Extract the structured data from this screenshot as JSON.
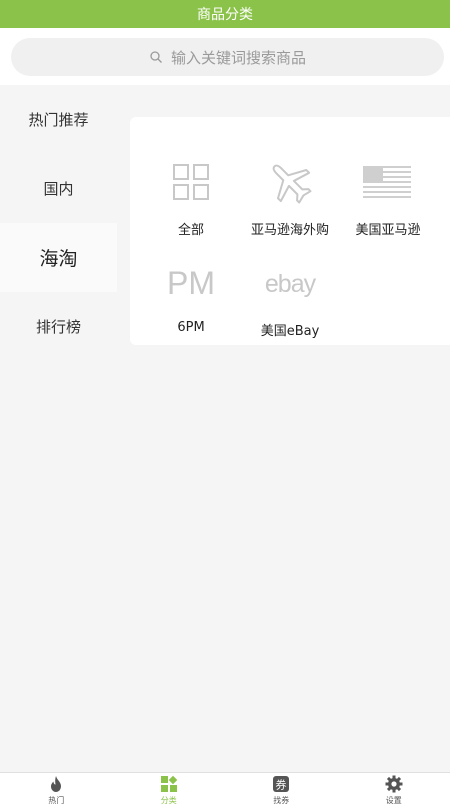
{
  "header": {
    "title": "商品分类"
  },
  "search": {
    "placeholder": "输入关键词搜索商品"
  },
  "sidebar": {
    "items": [
      {
        "label": "热门推荐",
        "active": false
      },
      {
        "label": "国内",
        "active": false
      },
      {
        "label": "海淘",
        "active": true
      },
      {
        "label": "排行榜",
        "active": false
      }
    ]
  },
  "categories": [
    {
      "label": "全部",
      "icon": "grid-icon"
    },
    {
      "label": "亚马逊海外购",
      "icon": "airplane-icon"
    },
    {
      "label": "美国亚马逊",
      "icon": "us-flag-icon"
    },
    {
      "label": "6PM",
      "icon": "6pm-logo",
      "logo_text": "PM"
    },
    {
      "label": "美国eBay",
      "icon": "ebay-logo",
      "logo_text": "ebay"
    }
  ],
  "bottom_nav": [
    {
      "label": "热门",
      "icon": "flame-icon",
      "active": false
    },
    {
      "label": "分类",
      "icon": "category-icon",
      "active": true
    },
    {
      "label": "找券",
      "icon": "coupon-icon",
      "badge": "券",
      "active": false
    },
    {
      "label": "设置",
      "icon": "gear-icon",
      "active": false
    }
  ],
  "colors": {
    "accent": "#8bc34a",
    "background": "#f5f5f5",
    "icon_gray": "#c8c8c8"
  }
}
